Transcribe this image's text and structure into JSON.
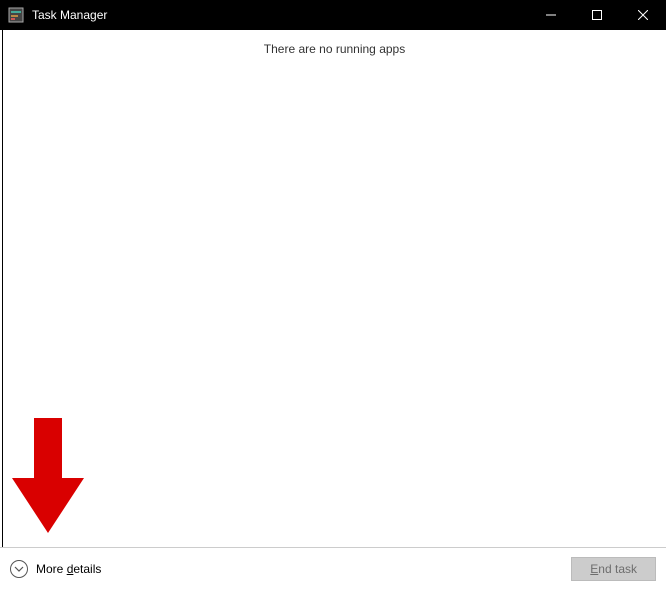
{
  "window": {
    "title": "Task Manager"
  },
  "main": {
    "empty_message": "There are no running apps"
  },
  "footer": {
    "more_details_prefix": "More ",
    "more_details_underlined": "d",
    "more_details_suffix": "etails",
    "end_task_underlined": "E",
    "end_task_suffix": "nd task"
  }
}
